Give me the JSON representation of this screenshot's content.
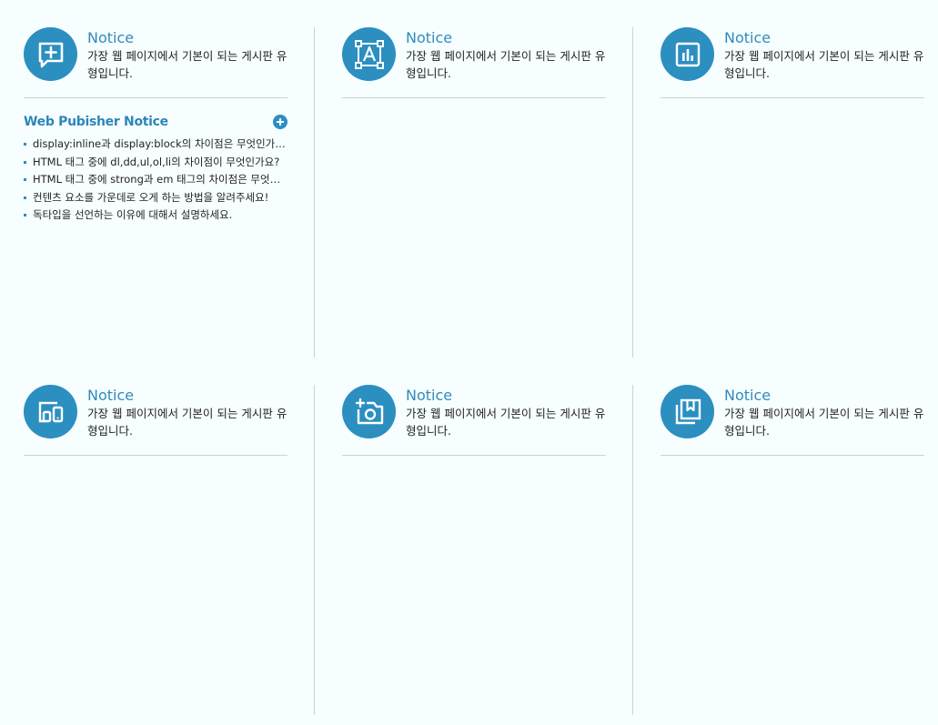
{
  "cards": [
    {
      "title": "Notice",
      "desc": "가장 웹 페이지에서 기본이 되는 게시판 유형입니다.",
      "icon": "chat-plus-icon"
    },
    {
      "title": "Notice",
      "desc": "가장 웹 페이지에서 기본이 되는 게시판 유형입니다.",
      "icon": "text-frame-icon"
    },
    {
      "title": "Notice",
      "desc": "가장 웹 페이지에서 기본이 되는 게시판 유형입니다.",
      "icon": "bar-chart-icon"
    },
    {
      "title": "Notice",
      "desc": "가장 웹 페이지에서 기본이 되는 게시판 유형입니다.",
      "icon": "devices-icon"
    },
    {
      "title": "Notice",
      "desc": "가장 웹 페이지에서 기본이 되는 게시판 유형입니다.",
      "icon": "add-photo-icon"
    },
    {
      "title": "Notice",
      "desc": "가장 웹 페이지에서 기본이 되는 게시판 유형입니다.",
      "icon": "bookmarks-icon"
    }
  ],
  "board": {
    "title": "Web Pubisher Notice",
    "more_icon": "plus-circle-icon",
    "items": [
      "display:inline과 display:block의 차이점은 무엇인가요?",
      "HTML 태그 중에 dl,dd,ul,ol,li의 차이점이 무엇인가요?",
      "HTML 태그 중에 strong과 em 태그의 차이점은 무엇인가요?",
      "컨텐츠 요소를 가운데로 오게 하는 방법을 알려주세요!",
      "독타입을 선언하는 이유에 대해서 설명하세요."
    ]
  },
  "colors": {
    "accent": "#2b8fc0",
    "title": "#2e8cbd",
    "divider": "#c9d2d5",
    "background": "#f7feff"
  }
}
